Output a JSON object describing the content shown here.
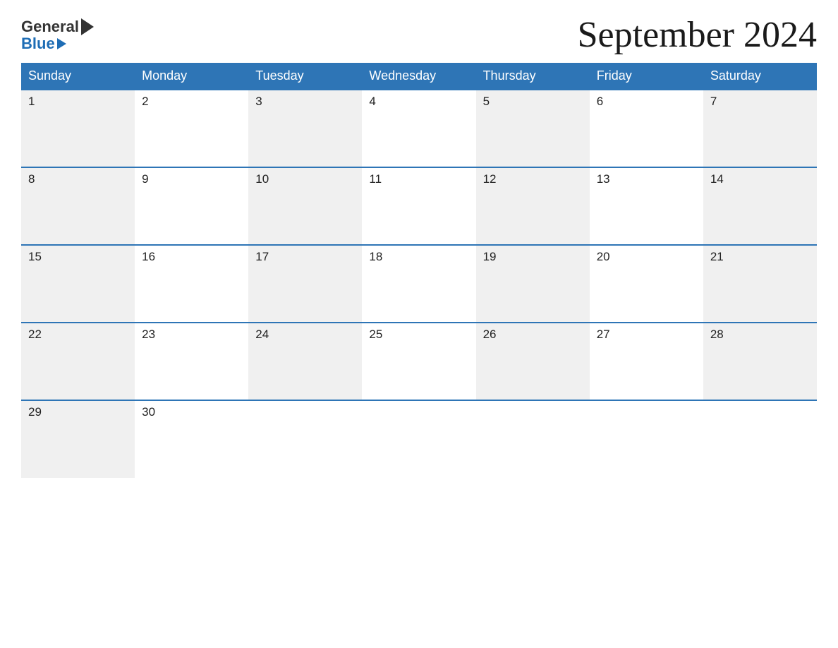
{
  "logo": {
    "text_general": "General",
    "text_blue": "Blue"
  },
  "header": {
    "title": "September 2024"
  },
  "calendar": {
    "days_of_week": [
      "Sunday",
      "Monday",
      "Tuesday",
      "Wednesday",
      "Thursday",
      "Friday",
      "Saturday"
    ],
    "weeks": [
      [
        {
          "day": "1",
          "empty": false
        },
        {
          "day": "2",
          "empty": false
        },
        {
          "day": "3",
          "empty": false
        },
        {
          "day": "4",
          "empty": false
        },
        {
          "day": "5",
          "empty": false
        },
        {
          "day": "6",
          "empty": false
        },
        {
          "day": "7",
          "empty": false
        }
      ],
      [
        {
          "day": "8",
          "empty": false
        },
        {
          "day": "9",
          "empty": false
        },
        {
          "day": "10",
          "empty": false
        },
        {
          "day": "11",
          "empty": false
        },
        {
          "day": "12",
          "empty": false
        },
        {
          "day": "13",
          "empty": false
        },
        {
          "day": "14",
          "empty": false
        }
      ],
      [
        {
          "day": "15",
          "empty": false
        },
        {
          "day": "16",
          "empty": false
        },
        {
          "day": "17",
          "empty": false
        },
        {
          "day": "18",
          "empty": false
        },
        {
          "day": "19",
          "empty": false
        },
        {
          "day": "20",
          "empty": false
        },
        {
          "day": "21",
          "empty": false
        }
      ],
      [
        {
          "day": "22",
          "empty": false
        },
        {
          "day": "23",
          "empty": false
        },
        {
          "day": "24",
          "empty": false
        },
        {
          "day": "25",
          "empty": false
        },
        {
          "day": "26",
          "empty": false
        },
        {
          "day": "27",
          "empty": false
        },
        {
          "day": "28",
          "empty": false
        }
      ],
      [
        {
          "day": "29",
          "empty": false
        },
        {
          "day": "30",
          "empty": false
        },
        {
          "day": "",
          "empty": true
        },
        {
          "day": "",
          "empty": true
        },
        {
          "day": "",
          "empty": true
        },
        {
          "day": "",
          "empty": true
        },
        {
          "day": "",
          "empty": true
        }
      ]
    ]
  },
  "colors": {
    "header_bg": "#2e75b6",
    "header_text": "#ffffff",
    "odd_cell_bg": "#f0f0f0",
    "even_cell_bg": "#ffffff",
    "border_color": "#2e75b6"
  }
}
